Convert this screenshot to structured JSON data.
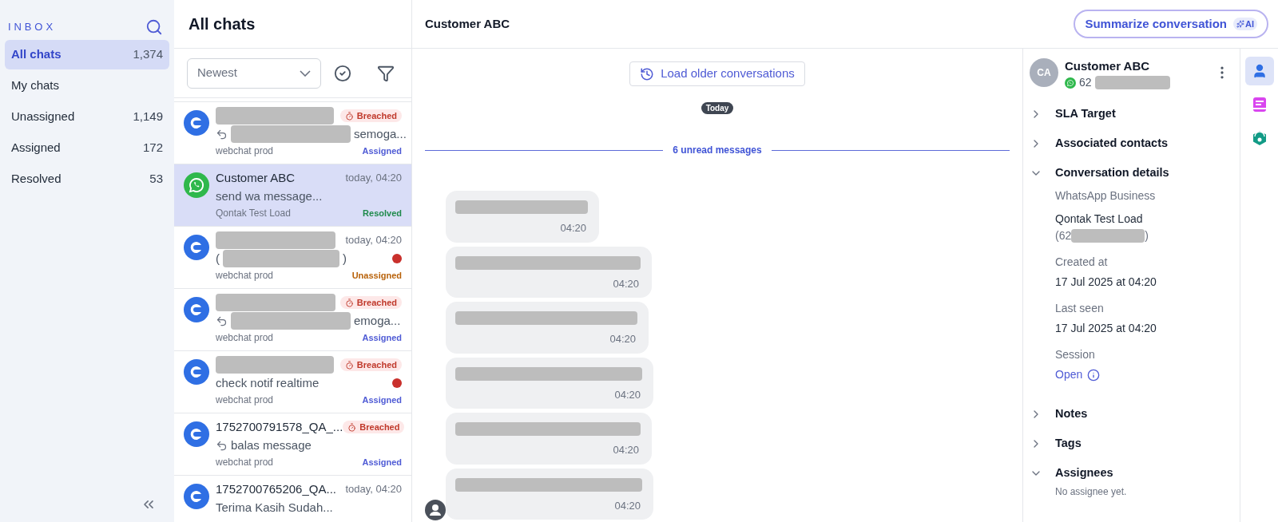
{
  "sidebar": {
    "title": "INBOX",
    "items": [
      {
        "label": "All chats",
        "count": "1,374",
        "selected": true
      },
      {
        "label": "My chats",
        "selected": false
      },
      {
        "label": "Unassigned",
        "count": "1,149",
        "selected": false
      },
      {
        "label": "Assigned",
        "count": "172",
        "selected": false
      },
      {
        "label": "Resolved",
        "count": "53",
        "selected": false
      }
    ]
  },
  "chat_list": {
    "title": "All chats",
    "sort": "Newest",
    "chats": [
      {
        "kind": "webchat",
        "badge": "Breached",
        "reply": true,
        "preview_after": "semoga...",
        "source": "webchat prod",
        "status": "Assigned",
        "color": "#4f5bd5",
        "unread": false,
        "selected": false
      },
      {
        "kind": "whatsapp",
        "name": "Customer ABC",
        "time": "today, 04:20",
        "reply": false,
        "preview": "send wa message...",
        "source": "Qontak Test Load",
        "status": "Resolved",
        "color": "#1f8a4c",
        "unread": false,
        "selected": true
      },
      {
        "kind": "webchat",
        "time": "today, 04:20",
        "reply": false,
        "preview_before": "(",
        "preview_after": ")",
        "source": "webchat prod",
        "status": "Unassigned",
        "color": "#b8620a",
        "unread": true,
        "selected": false
      },
      {
        "kind": "webchat",
        "badge": "Breached",
        "reply": true,
        "preview_after": "emoga...",
        "source": "webchat prod",
        "status": "Assigned",
        "color": "#4f5bd5",
        "unread": false,
        "selected": false
      },
      {
        "kind": "webchat",
        "badge": "Breached",
        "reply": false,
        "preview": "check notif realtime",
        "source": "webchat prod",
        "status": "Assigned",
        "color": "#4f5bd5",
        "unread": true,
        "selected": false
      },
      {
        "kind": "webchat",
        "name": "1752700791578_QA_...",
        "badge": "Breached",
        "reply": true,
        "preview": "balas message",
        "source": "webchat prod",
        "status": "Assigned",
        "color": "#4f5bd5",
        "unread": false,
        "selected": false
      },
      {
        "kind": "webchat",
        "name": "1752700765206_QA...",
        "time": "today, 04:20",
        "reply": false,
        "preview": "Terima Kasih Sudah...",
        "unread": false,
        "selected": false
      }
    ]
  },
  "conversation": {
    "title": "Customer ABC",
    "summarize": "Summarize conversation",
    "ai_tag": "AI",
    "load_older": "Load older conversations",
    "day": "Today",
    "unread_divider": "6 unread messages",
    "messages": [
      {
        "time": "04:20"
      },
      {
        "time": "04:20"
      },
      {
        "time": "04:20"
      },
      {
        "time": "04:20"
      },
      {
        "time": "04:20"
      },
      {
        "time": "04:20"
      }
    ]
  },
  "contact": {
    "initials": "CA",
    "name": "Customer ABC",
    "phone_prefix": "62",
    "sections": [
      {
        "title": "SLA Target",
        "expanded": false
      },
      {
        "title": "Associated contacts",
        "expanded": false
      },
      {
        "title": "Conversation details",
        "expanded": true,
        "kind": "details",
        "channel": "WhatsApp Business",
        "inbox": "Qontak Test Load",
        "number_before": "(62",
        "number_after": ")",
        "fields": [
          {
            "label": "Created at",
            "value": "17 Jul 2025 at 04:20"
          },
          {
            "label": "Last seen",
            "value": "17 Jul 2025 at 04:20"
          }
        ],
        "session_label": "Session",
        "session_value": "Open"
      },
      {
        "title": "Notes",
        "expanded": false
      },
      {
        "title": "Tags",
        "expanded": false
      },
      {
        "title": "Assignees",
        "expanded": true,
        "kind": "empty",
        "note": "No assignee yet."
      }
    ]
  },
  "rail": [
    {
      "kind": "contact",
      "selected": true
    },
    {
      "kind": "notes",
      "selected": false
    },
    {
      "kind": "bot",
      "selected": false
    }
  ]
}
